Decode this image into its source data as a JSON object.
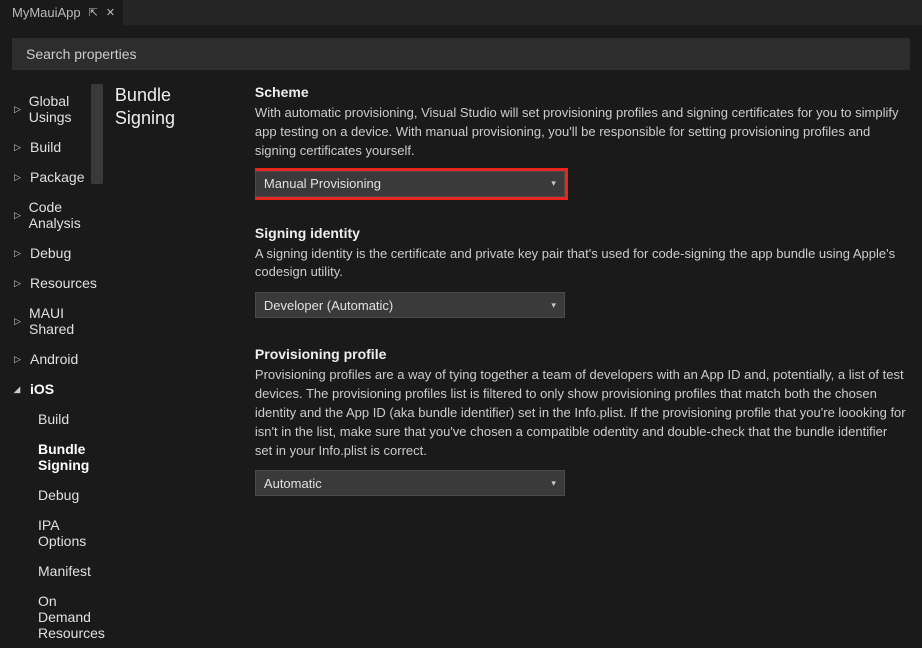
{
  "tab": {
    "title": "MyMauiApp"
  },
  "search": {
    "placeholder": "Search properties"
  },
  "sidebar": {
    "items": [
      {
        "label": "Global Usings"
      },
      {
        "label": "Build"
      },
      {
        "label": "Package"
      },
      {
        "label": "Code Analysis"
      },
      {
        "label": "Debug"
      },
      {
        "label": "Resources"
      },
      {
        "label": "MAUI Shared"
      },
      {
        "label": "Android"
      },
      {
        "label": "iOS"
      }
    ],
    "ios_children": [
      {
        "label": "Build"
      },
      {
        "label": "Bundle Signing"
      },
      {
        "label": "Debug"
      },
      {
        "label": "IPA Options"
      },
      {
        "label": "Manifest"
      },
      {
        "label": "On Demand Resources"
      }
    ]
  },
  "section": {
    "title_line1": "Bundle",
    "title_line2": "Signing"
  },
  "fields": {
    "scheme": {
      "label": "Scheme",
      "desc": "With automatic provisioning, Visual Studio will set provisioning profiles and signing certificates for you to simplify app testing on a device. With manual provisioning, you'll be responsible for setting provisioning profiles and signing certificates yourself.",
      "value": "Manual Provisioning"
    },
    "identity": {
      "label": "Signing identity",
      "desc": "A signing identity is the certificate and private key pair that's used for code-signing the app bundle using Apple's codesign utility.",
      "value": "Developer (Automatic)"
    },
    "profile": {
      "label": "Provisioning profile",
      "desc": "Provisioning profiles are a way of tying together a team of developers with an App ID and, potentially, a list of test devices. The provisioning profiles list is filtered to only show provisioning profiles that match both the chosen identity and the App ID (aka bundle identifier) set in the Info.plist. If the provisioning profile that you're loooking for isn't in the list, make sure that you've chosen a compatible odentity and double-check that the bundle identifier set in your Info.plist is correct.",
      "value": "Automatic"
    }
  }
}
